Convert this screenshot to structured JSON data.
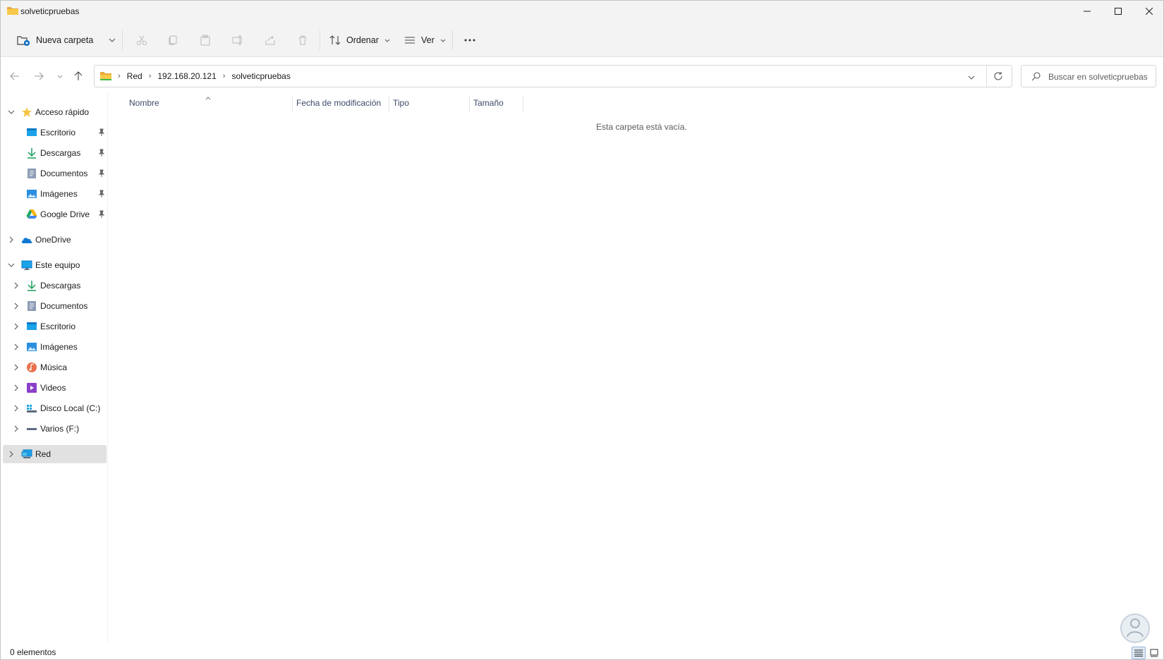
{
  "window": {
    "title": "solveticpruebas"
  },
  "toolbar": {
    "new_folder_label": "Nueva carpeta",
    "sort_label": "Ordenar",
    "view_label": "Ver"
  },
  "address": {
    "crumbs": [
      "Red",
      "192.168.20.121",
      "solveticpruebas"
    ]
  },
  "search": {
    "placeholder": "Buscar en solveticpruebas"
  },
  "sidebar": {
    "quick_access": "Acceso rápido",
    "quick_items": [
      "Escritorio",
      "Descargas",
      "Documentos",
      "Imágenes",
      "Google Drive"
    ],
    "onedrive": "OneDrive",
    "this_pc": "Este equipo",
    "pc_items": [
      "Descargas",
      "Documentos",
      "Escritorio",
      "Imágenes",
      "Música",
      "Videos",
      "Disco Local (C:)",
      "Varios (F:)"
    ],
    "network": "Red"
  },
  "columns": {
    "name": "Nombre",
    "modified": "Fecha de modificación",
    "type": "Tipo",
    "size": "Tamaño"
  },
  "content": {
    "empty_message": "Esta carpeta está vacía."
  },
  "status": {
    "count": "0 elementos"
  },
  "colors": {
    "accent": "#0067c0",
    "selected": "#e1e1e1",
    "folder_yellow": "#f6c343"
  }
}
